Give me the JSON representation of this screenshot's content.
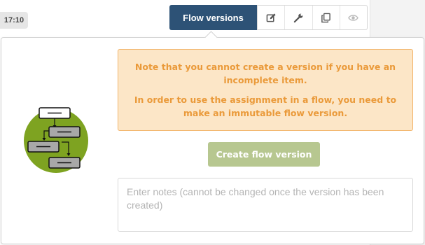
{
  "timestamp": "17:10",
  "toolbar": {
    "flow_versions_label": "Flow versions",
    "buttons": [
      {
        "icon": "edit-icon",
        "color": "#555555"
      },
      {
        "icon": "wrench-icon",
        "color": "#555555"
      },
      {
        "icon": "copy-icon",
        "color": "#555555"
      },
      {
        "icon": "eye-icon",
        "color": "#bbbbbb"
      }
    ]
  },
  "popover": {
    "illustration_icon": "flow-diagram-icon",
    "warning": {
      "line1": "Note that you cannot create a version if you have an incomplete item.",
      "line2": "In order to use the assignment in a flow, you need to make an immutable flow version."
    },
    "create_button_label": "Create flow version",
    "notes_placeholder": "Enter notes (cannot be changed once the version has been created)",
    "notes_value": ""
  },
  "colors": {
    "primary": "#2d5276",
    "warning_bg": "#fce6c7",
    "warning_text": "#ea9a3a",
    "create_button": "#b7c790",
    "illustration_circle": "#7ea321"
  }
}
